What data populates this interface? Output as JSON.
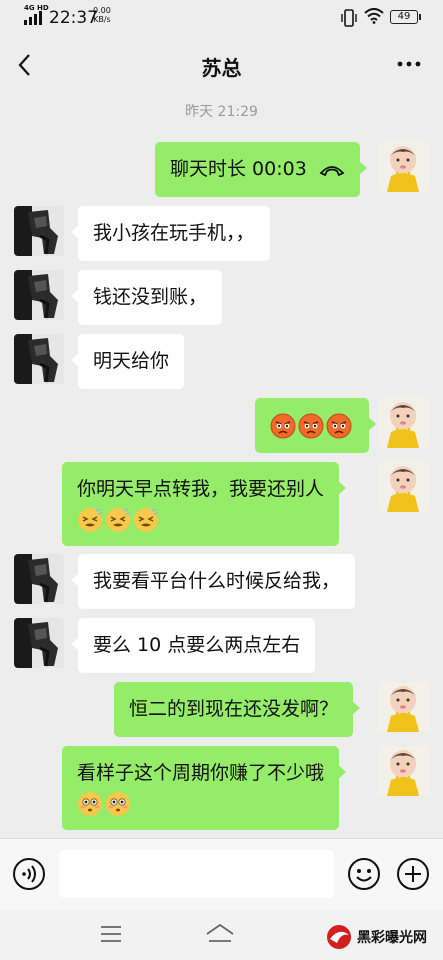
{
  "status_bar": {
    "network": "4G HD",
    "time": "22:37",
    "speed_value": "0.00",
    "speed_unit": "KB/s",
    "battery": "49"
  },
  "header": {
    "title": "苏总",
    "back_icon": "back-chevron-icon",
    "more_icon": "more-dots-icon"
  },
  "chat": {
    "timestamp": "昨天 21:29",
    "messages": [
      {
        "side": "out",
        "text": "聊天时长 00:03",
        "icon": "phone-hangup-icon"
      },
      {
        "side": "in",
        "text": "我小孩在玩手机，，"
      },
      {
        "side": "in",
        "text": "钱还没到账，"
      },
      {
        "side": "in",
        "text": "明天给你"
      },
      {
        "side": "out",
        "text": "",
        "emoji": [
          "angry-face-emoji",
          "angry-face-emoji",
          "angry-face-emoji"
        ]
      },
      {
        "side": "out",
        "text": "你明天早点转我，我要还别人",
        "emoji": [
          "frustrated-face-emoji",
          "frustrated-face-emoji",
          "frustrated-face-emoji"
        ]
      },
      {
        "side": "in",
        "text": "我要看平台什么时候反给我，"
      },
      {
        "side": "in",
        "text": "要么 10 点要么两点左右"
      },
      {
        "side": "out",
        "text": "恒二的到现在还没发啊？"
      },
      {
        "side": "out",
        "text": "看样子这个周期你赚了不少哦",
        "emoji": [
          "flushed-face-emoji",
          "flushed-face-emoji"
        ]
      }
    ]
  },
  "input_bar": {
    "voice_icon": "voice-icon",
    "placeholder": "",
    "emoji_icon": "smiley-icon",
    "plus_icon": "plus-icon"
  },
  "nav_bar": {
    "menu_icon": "menu-icon",
    "home_icon": "home-icon"
  },
  "watermark": {
    "text": "黑彩曝光网"
  },
  "colors": {
    "background": "#ededed",
    "bubble_out": "#95ec69",
    "bubble_in": "#ffffff"
  }
}
